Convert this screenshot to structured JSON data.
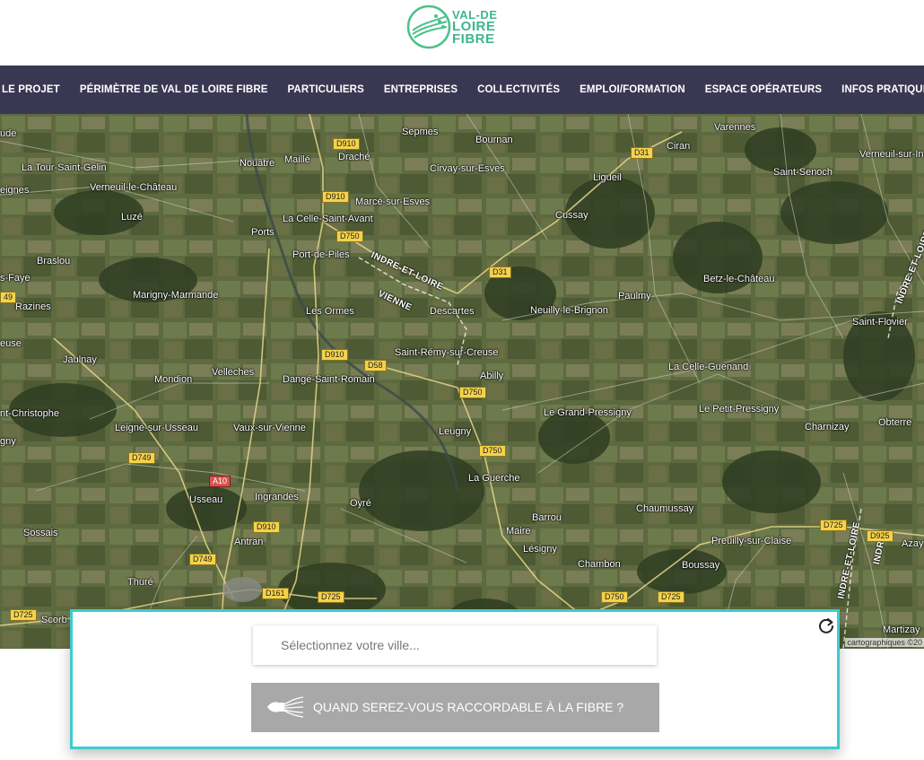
{
  "brand": {
    "logo_icon": "fiber-globe-icon",
    "logo_lines": [
      "VAL-DE",
      "LOIRE",
      "FIBRE"
    ],
    "accent": "#3fb58f"
  },
  "nav": {
    "background": "#3a3752",
    "items": [
      {
        "label": "LE PROJET"
      },
      {
        "label": "PÉRIMÈTRE DE VAL DE LOIRE FIBRE"
      },
      {
        "label": "PARTICULIERS"
      },
      {
        "label": "ENTREPRISES"
      },
      {
        "label": "COLLECTIVITÉS"
      },
      {
        "label": "EMPLOI/FORMATION"
      },
      {
        "label": "ESPACE OPÉRATEURS"
      },
      {
        "label": "INFOS PRATIQUES"
      }
    ]
  },
  "map": {
    "places": [
      "ude",
      "La Tour-Saint-Gelin",
      "eignes",
      "Verneuil-le-Château",
      "Luzé",
      "Braslou",
      "s-Faye",
      "Razines",
      "Marigny-Marmande",
      "euse",
      "Jaulnay",
      "Mondion",
      "Velleches",
      "nt-Christophe",
      "Leigné-sur-Usseau",
      "gny",
      "Vaux-sur-Vienne",
      "Usseau",
      "Sossais",
      "Thuré",
      "Scorb",
      "Nouâtre",
      "Maillé",
      "Draché",
      "La Celle-Saint-Avant",
      "Ports",
      "Marcé-sur-Esves",
      "Port-de-Piles",
      "Les Ormes",
      "Dangé-Saint-Romain",
      "Ingrandes",
      "Antran",
      "Oyré",
      "Sepmes",
      "Bournan",
      "Cirvay-sur-Esves",
      "Descartes",
      "Saint-Rémy-sur-Creuse",
      "Abilly",
      "Leugny",
      "La Guerche",
      "Barrou",
      "Maire",
      "Lésigny",
      "Chambon",
      "Ligueil",
      "Cussay",
      "Ciran",
      "Varennes",
      "Saint-Senoch",
      "Verneuil-sur-In",
      "Paulmy",
      "Neuilly-le-Brignon",
      "Betz-le-Château",
      "Saint-Flovier",
      "La Celle-Guenand",
      "Le Grand-Pressigny",
      "Le Petit-Pressigny",
      "Charnizay",
      "Obterre",
      "Chaumussay",
      "Preuilly-sur-Claise",
      "Boussay",
      "Azay",
      "Martizay"
    ],
    "departments": [
      "INDRE-ET-LOIRE",
      "VIENNE",
      "INDRE-ET-LOIRE",
      "INDRE",
      "INDRE-ET-LOIRE"
    ],
    "roads": [
      "D910",
      "D910",
      "D750",
      "D31",
      "D31",
      "D910",
      "D58",
      "D750",
      "D750",
      "A10",
      "D749",
      "D910",
      "D749",
      "D161",
      "D725",
      "D725",
      "D750",
      "D725",
      "D725",
      "D925",
      "49"
    ],
    "copyright": "cartographiques ©20"
  },
  "search": {
    "placeholder": "Sélectionnez votre ville...",
    "button_label": "QUAND SEREZ-VOUS RACCORDABLE À LA FIBRE ?",
    "button_icon": "fiber-cable-icon",
    "refresh_icon": "refresh-icon",
    "border_color": "#3ecbcf"
  }
}
